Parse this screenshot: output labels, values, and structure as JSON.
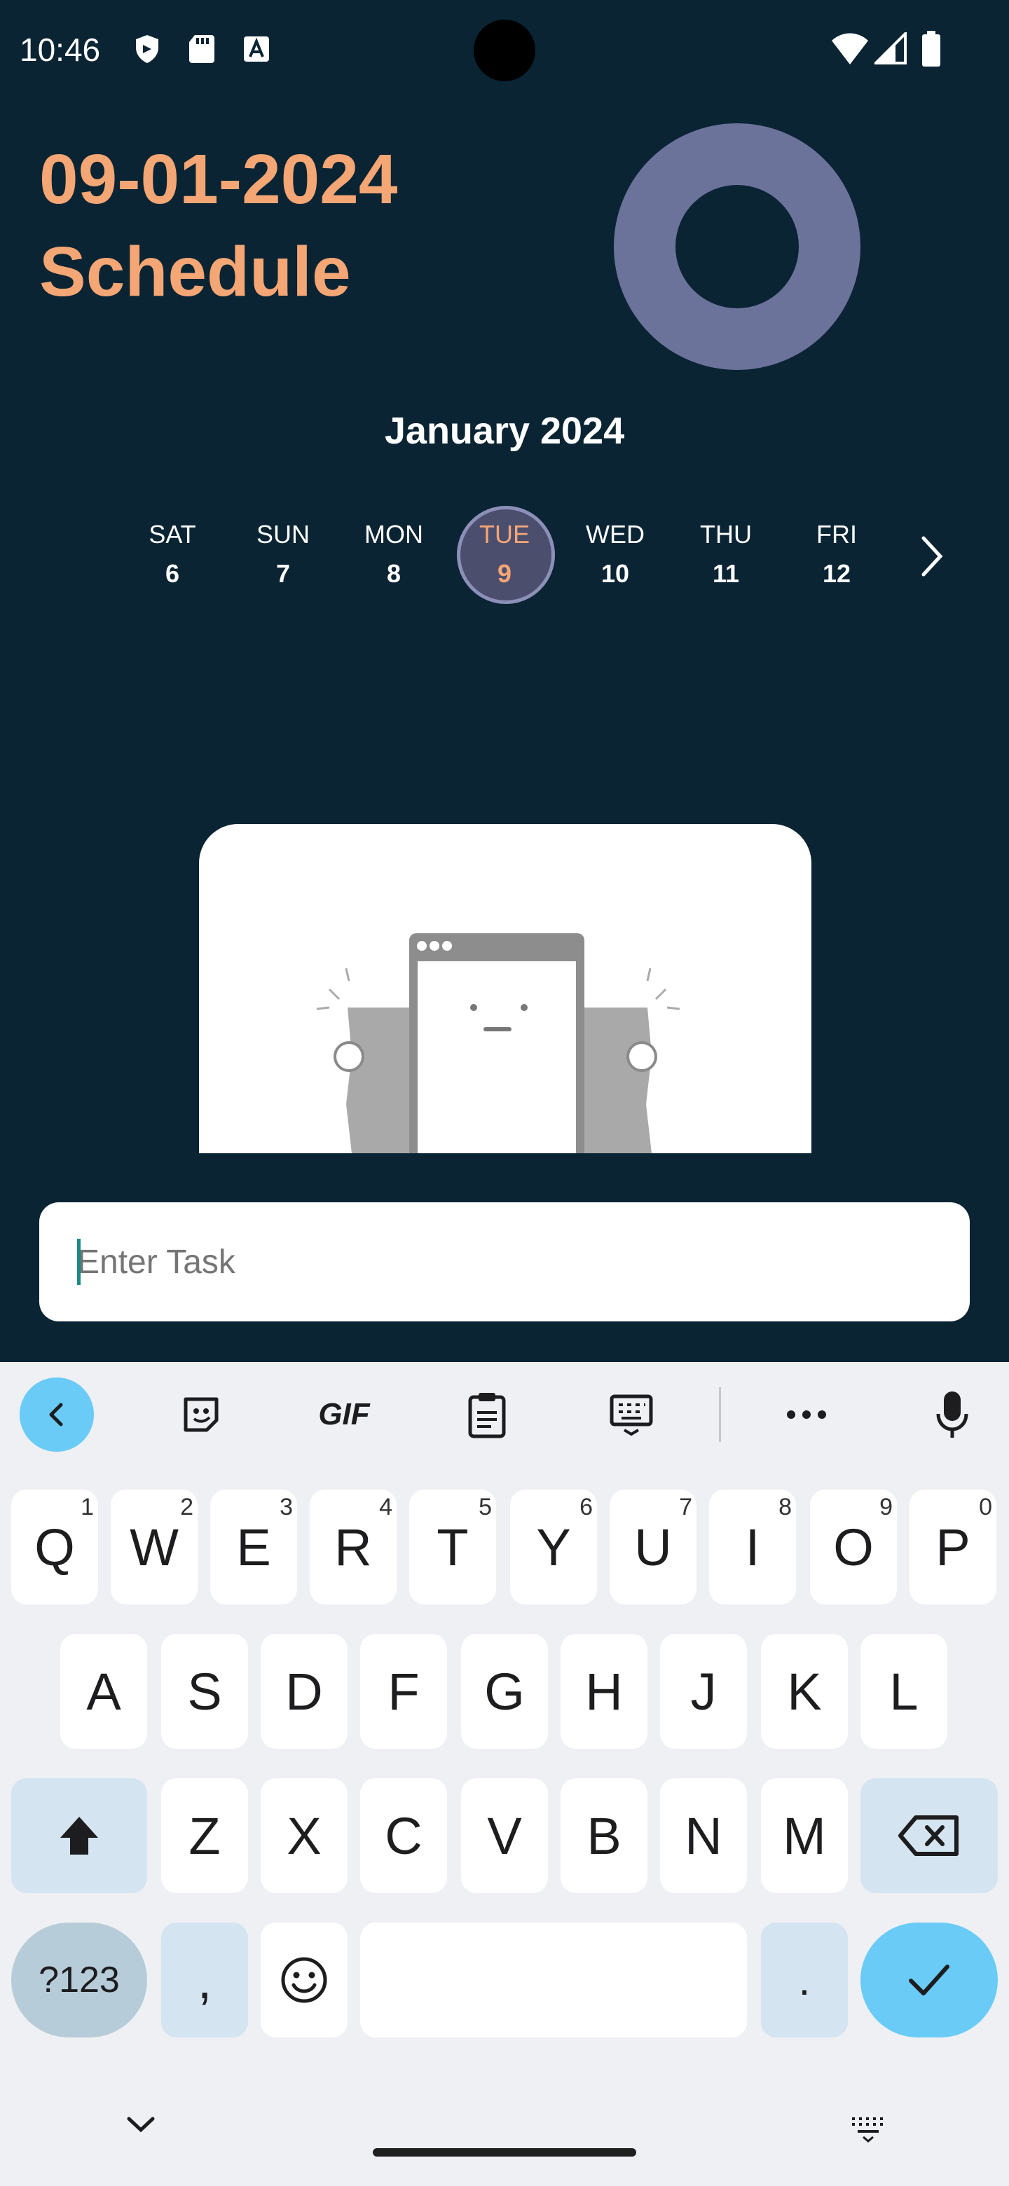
{
  "status": {
    "time": "10:46"
  },
  "header": {
    "date": "09-01-2024",
    "subtitle": "Schedule"
  },
  "calendar": {
    "month": "January 2024",
    "days": [
      {
        "name": "SAT",
        "num": "6"
      },
      {
        "name": "SUN",
        "num": "7"
      },
      {
        "name": "MON",
        "num": "8"
      },
      {
        "name": "TUE",
        "num": "9",
        "selected": true
      },
      {
        "name": "WED",
        "num": "10"
      },
      {
        "name": "THU",
        "num": "11"
      },
      {
        "name": "FRI",
        "num": "12"
      }
    ]
  },
  "task": {
    "placeholder": "Enter Task",
    "value": ""
  },
  "colors": {
    "background": "#0a2433",
    "accent": "#f4a675",
    "ring": "#6c739b",
    "keyboard_bg": "#eef0f3",
    "keyboard_accent": "#6acbf6"
  },
  "keyboard": {
    "toolbar": [
      "back-icon",
      "sticker-icon",
      "gif-icon",
      "clipboard-icon",
      "keyboard-layout-icon",
      "more-icon",
      "mic-icon"
    ],
    "gif_label": "GIF",
    "row1": [
      {
        "key": "Q",
        "hint": "1"
      },
      {
        "key": "W",
        "hint": "2"
      },
      {
        "key": "E",
        "hint": "3"
      },
      {
        "key": "R",
        "hint": "4"
      },
      {
        "key": "T",
        "hint": "5"
      },
      {
        "key": "Y",
        "hint": "6"
      },
      {
        "key": "U",
        "hint": "7"
      },
      {
        "key": "I",
        "hint": "8"
      },
      {
        "key": "O",
        "hint": "9"
      },
      {
        "key": "P",
        "hint": "0"
      }
    ],
    "row2": [
      "A",
      "S",
      "D",
      "F",
      "G",
      "H",
      "J",
      "K",
      "L"
    ],
    "row3": [
      "Z",
      "X",
      "C",
      "V",
      "B",
      "N",
      "M"
    ],
    "symbols_label": "?123",
    "comma_label": ",",
    "period_label": "."
  }
}
